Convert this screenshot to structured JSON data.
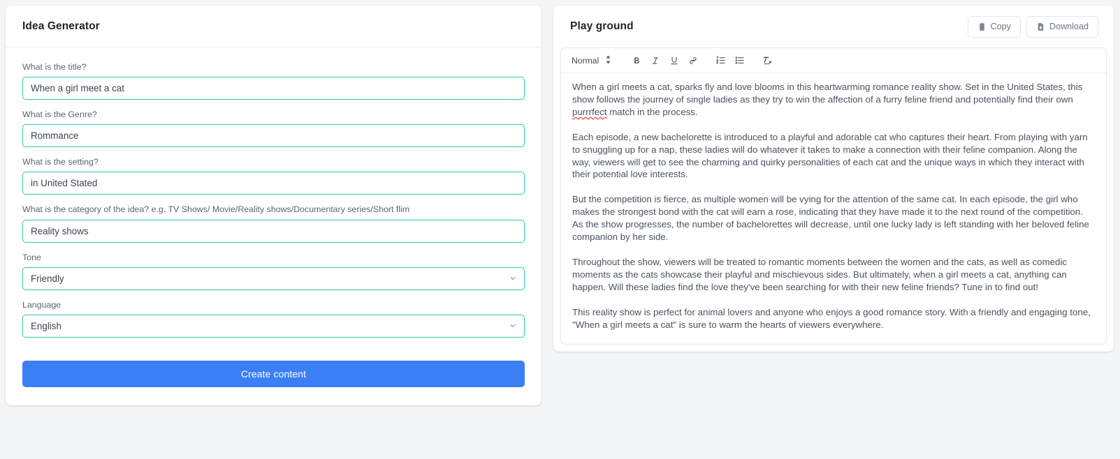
{
  "left_panel": {
    "title": "Idea Generator",
    "fields": [
      {
        "label": "What is the title?",
        "value": "When a girl meet a cat",
        "type": "text",
        "name": "title"
      },
      {
        "label": "What is the Genre?",
        "value": "Rommance",
        "type": "text",
        "name": "genre"
      },
      {
        "label": "What is the setting?",
        "value": "in United Stated",
        "type": "text",
        "name": "setting"
      },
      {
        "label": "What is the category of the idea? e.g. TV Shows/ Movie/Reality shows/Documentary series/Short flim",
        "value": "Reality shows",
        "type": "text",
        "name": "category"
      },
      {
        "label": "Tone",
        "value": "Friendly",
        "type": "select",
        "name": "tone"
      },
      {
        "label": "Language",
        "value": "English",
        "type": "select",
        "name": "language"
      }
    ],
    "submit_label": "Create content"
  },
  "right_panel": {
    "title": "Play ground",
    "copy_label": "Copy",
    "download_label": "Download",
    "copy_icon": "clipboard-icon",
    "download_icon": "file-download-icon",
    "toolbar": {
      "format_value": "Normal",
      "format_picker_icon": "up-down-arrows-icon",
      "buttons": [
        {
          "name": "bold-button",
          "icon": "bold-icon",
          "label": "B"
        },
        {
          "name": "italic-button",
          "icon": "italic-icon",
          "label": "I"
        },
        {
          "name": "underline-button",
          "icon": "underline-icon",
          "label": "U"
        },
        {
          "name": "link-button",
          "icon": "link-icon",
          "label": ""
        },
        {
          "name": "ordered-list-button",
          "icon": "ordered-list-icon",
          "label": ""
        },
        {
          "name": "bullet-list-button",
          "icon": "bullet-list-icon",
          "label": ""
        },
        {
          "name": "clear-format-button",
          "icon": "clear-formatting-icon",
          "label": "Tx"
        }
      ]
    },
    "content": {
      "paragraph_1_a": "When a girl meets a cat, sparks fly and love blooms in this heartwarming romance reality show. Set in the United States, this show follows the journey of single ladies as they try to win the affection of a furry feline friend and potentially find their own ",
      "paragraph_1_misspelled": "purrrfect",
      "paragraph_1_b": " match in the process.",
      "paragraph_2": "Each episode, a new bachelorette is introduced to a playful and adorable cat who captures their heart. From playing with yarn to snuggling up for a nap, these ladies will do whatever it takes to make a connection with their feline companion. Along the way, viewers will get to see the charming and quirky personalities of each cat and the unique ways in which they interact with their potential love interests.",
      "paragraph_3": "But the competition is fierce, as multiple women will be vying for the attention of the same cat. In each episode, the girl who makes the strongest bond with the cat will earn a rose, indicating that they have made it to the next round of the competition. As the show progresses, the number of bachelorettes will decrease, until one lucky lady is left standing with her beloved feline companion by her side.",
      "paragraph_4": "Throughout the show, viewers will be treated to romantic moments between the women and the cats, as well as comedic moments as the cats showcase their playful and mischievous sides. But ultimately, when a girl meets a cat, anything can happen. Will these ladies find the love they've been searching for with their new feline friends? Tune in to find out!",
      "paragraph_5": "This reality show is perfect for animal lovers and anyone who enjoys a good romance story. With a friendly and engaging tone, \"When a girl meets a cat\" is sure to warm the hearts of viewers everywhere."
    }
  },
  "colors": {
    "accent_teal": "#2ec7a4",
    "primary_blue": "#3b7ff6",
    "page_background": "#f4f5f7",
    "text_dark": "#212529",
    "text_muted": "#5a6570",
    "spellcheck_red": "#e0544e"
  }
}
